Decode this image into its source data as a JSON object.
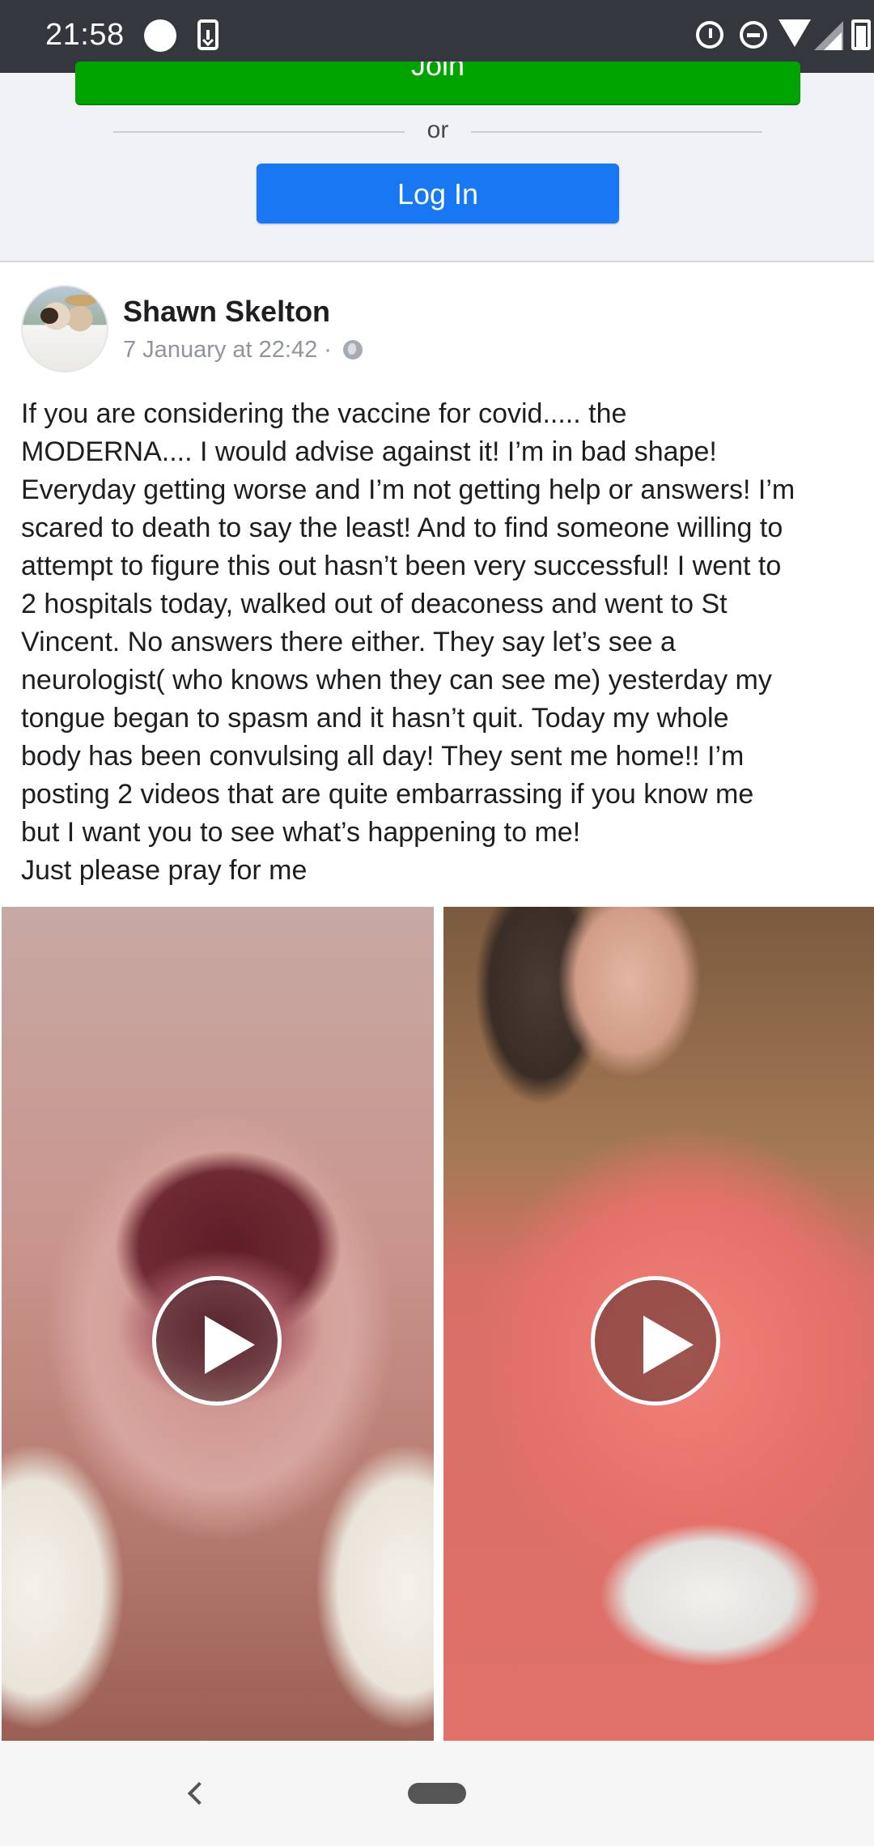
{
  "status_bar": {
    "time": "21:58",
    "icons": [
      "dot-icon",
      "download-icon",
      "alarm-icon",
      "do-not-disturb-icon",
      "wifi-icon",
      "signal-icon",
      "battery-icon"
    ]
  },
  "auth": {
    "join_label": "Join",
    "or_label": "or",
    "login_label": "Log In"
  },
  "post": {
    "author": "Shawn Skelton",
    "timestamp": "7 January at 22:42",
    "separator": "·",
    "privacy_icon": "globe-icon",
    "text": "If you are considering the vaccine for covid..... the\nMODERNA.... I would advise against it! I’m in bad shape!\nEveryday getting worse and I’m not getting help or answers! I’m\nscared to death to say the least! And to find someone willing to\nattempt to figure this out hasn’t been very successful! I went to\n2 hospitals today, walked out of deaconess and went to St\nVincent. No answers there either. They say let’s see a\nneurologist( who knows when they can see me) yesterday my\ntongue began to spasm and it hasn’t quit. Today my whole\nbody has been convulsing all day! They sent me home!! I’m\nposting 2 videos that are quite embarrassing if you know me\nbut I want you to see what’s happening to me!\nJust please pray for me",
    "videos": [
      {
        "name": "video-1",
        "icon": "play-icon"
      },
      {
        "name": "video-2",
        "icon": "play-icon"
      }
    ]
  },
  "colors": {
    "join_green": "#00a400",
    "login_blue": "#1877f2",
    "status_bar": "#34373d",
    "top_area_bg": "#f0f2f5"
  }
}
